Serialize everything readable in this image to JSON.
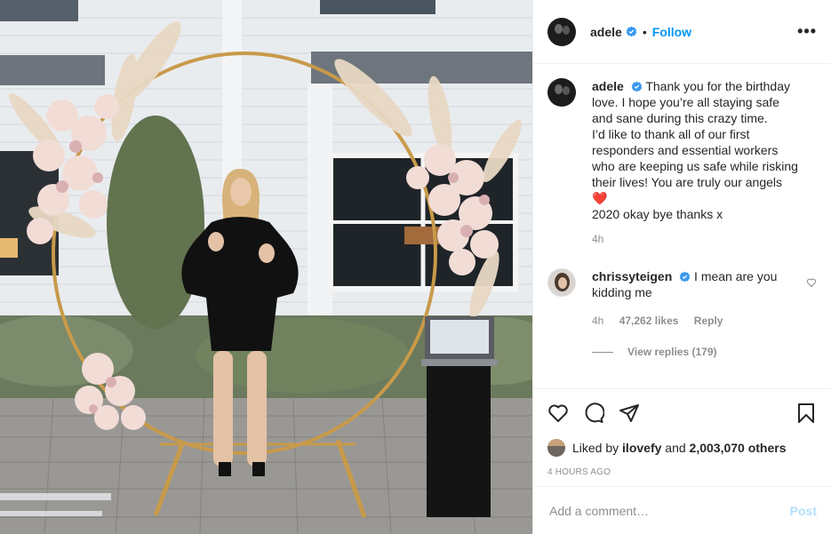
{
  "colors": {
    "accent": "#0095f6",
    "post_disabled": "#b2dffc",
    "heart": "#ed4956",
    "muted": "#8e8e8e"
  },
  "header": {
    "username": "adele",
    "separator": "•",
    "follow_label": "Follow",
    "more_label": "•••"
  },
  "caption": {
    "username": "adele",
    "lines": [
      "Thank you for the birthday",
      "love. I hope you’re all staying safe",
      "and sane during this crazy time.",
      "I’d like to thank all of our first",
      "responders and essential workers",
      "who are keeping us safe while risking",
      "their lives! You are truly our angels"
    ],
    "emoji": "❤️",
    "last_line": "2020 okay bye thanks x",
    "time": "4h"
  },
  "comment": {
    "username": "chrissyteigen",
    "line1": "I mean are you",
    "line2": "kidding me",
    "time": "4h",
    "likes": "47,262 likes",
    "reply": "Reply",
    "view_replies": "View replies (179)"
  },
  "actions": {
    "liked_by_prefix": "Liked by",
    "liked_by_user": "ilovefy",
    "and": "and",
    "others": "2,003,070 others",
    "time_ago": "4 HOURS AGO"
  },
  "add_comment": {
    "placeholder": "Add a comment…",
    "post_label": "Post"
  }
}
